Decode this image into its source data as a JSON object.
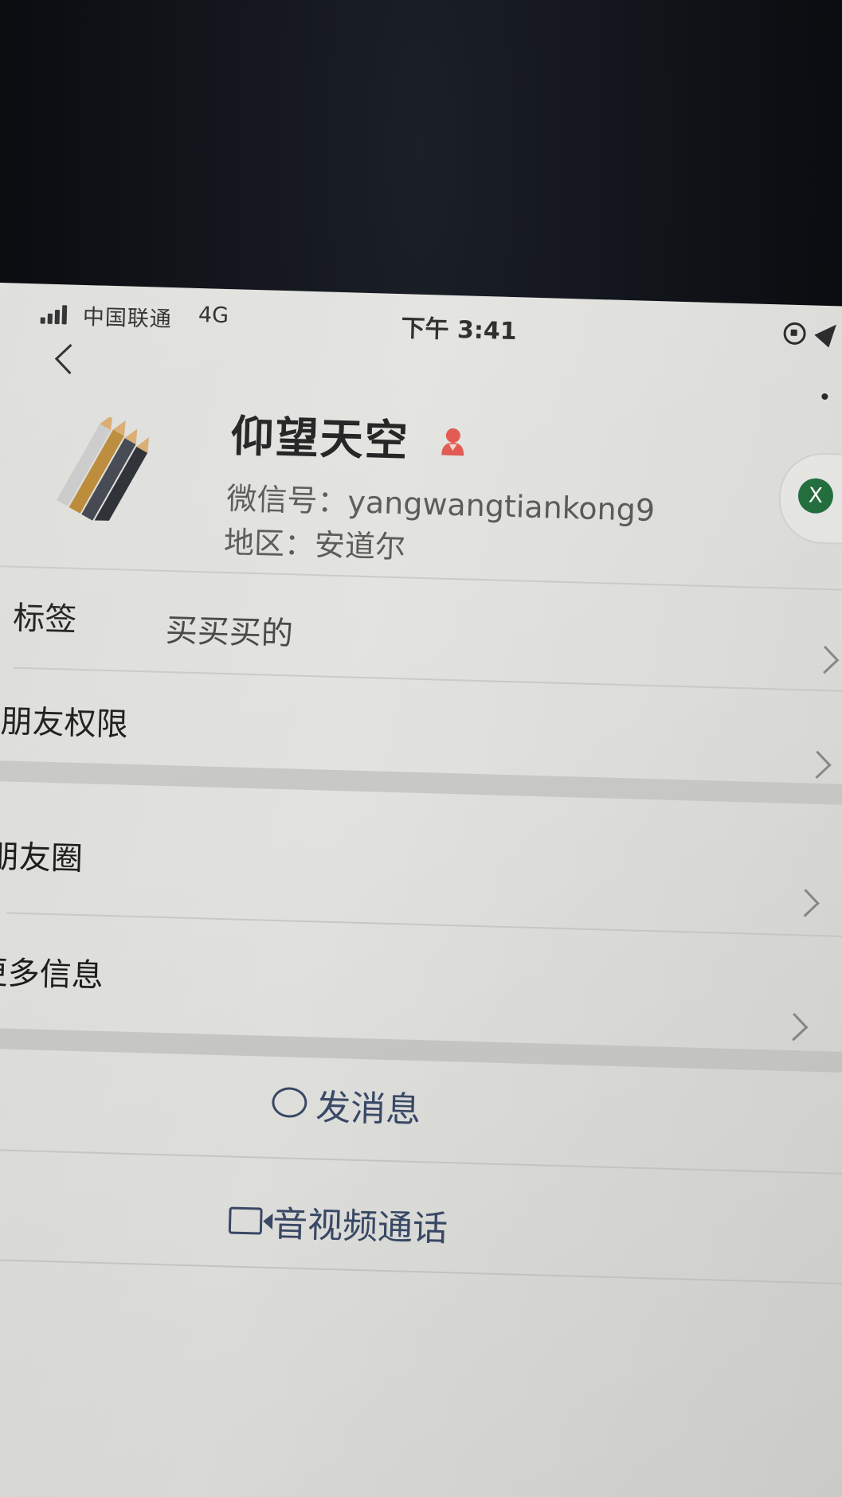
{
  "status_bar": {
    "carrier": "中国联通",
    "network": "4G",
    "time": "下午 3:41"
  },
  "icons": {
    "back": "chevron-left-icon",
    "gender": "female-icon",
    "more": "more-dots-icon",
    "chevron": "chevron-right-icon",
    "message": "chat-bubble-icon",
    "video": "video-camera-icon"
  },
  "profile": {
    "name": "仰望天空",
    "wechat_id": "微信号：yangwangtiankong9",
    "region": "地区：安道尔",
    "badge_letter": "X"
  },
  "rows": [
    {
      "label": "标签",
      "value": "买买买的"
    },
    {
      "label": "朋友权限",
      "value": ""
    },
    {
      "label": "朋友圈",
      "value": ""
    },
    {
      "label": "更多信息",
      "value": ""
    }
  ],
  "actions": {
    "message": "发消息",
    "video_call": "音视频通话"
  },
  "colors": {
    "action_text": "#3a4a68",
    "gender_icon": "#e0534a",
    "badge_green": "#1f6b3a"
  }
}
